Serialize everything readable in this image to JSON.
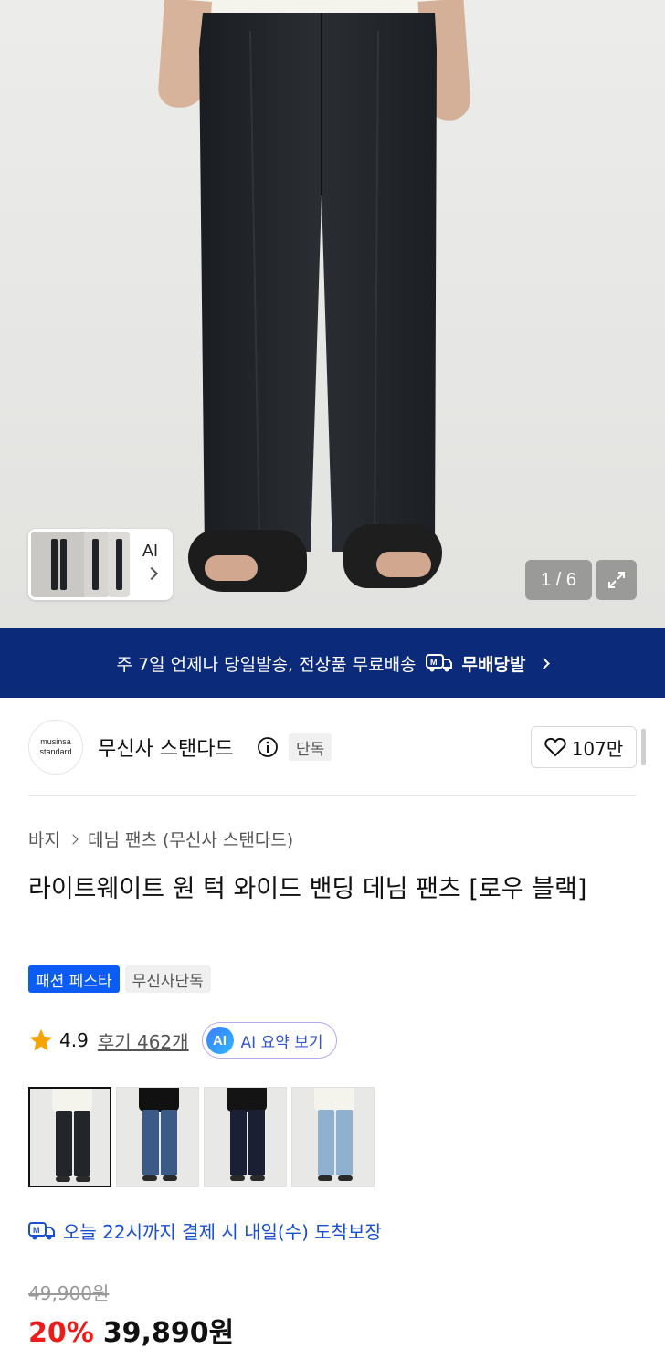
{
  "gallery": {
    "thumb_label": "AI",
    "counter": "1 / 6"
  },
  "banner": {
    "text": "주 7일 언제나 당일발송, 전상품 무료배송",
    "badge": "무배당발"
  },
  "brand": {
    "logo_line1": "musinsa",
    "logo_line2": "standard",
    "name": "무신사 스탠다드",
    "exclusive": "단독",
    "likes": "107만"
  },
  "breadcrumb": {
    "category": "바지",
    "subcategory": "데님 팬츠 (무신사 스탠다드)"
  },
  "product": {
    "title": "라이트웨이트 원 턱 와이드 밴딩 데님 팬츠 [로우 블랙]",
    "tags": [
      "패션 페스타",
      "무신사단독"
    ],
    "rating": "4.9",
    "review_link": "후기 462개",
    "ai_badge": "AI",
    "ai_summary": "AI 요약 보기",
    "delivery": "오늘 22시까지 결제 시 내일(수) 도착보장",
    "original_price": "49,900원",
    "discount": "20%",
    "price": "39,890원"
  },
  "colors": {
    "accent": "#0c2a7a",
    "tag_blue": "#0a5cf5",
    "discount_red": "#ee1b1b",
    "delivery_blue": "#1a4fcf"
  }
}
